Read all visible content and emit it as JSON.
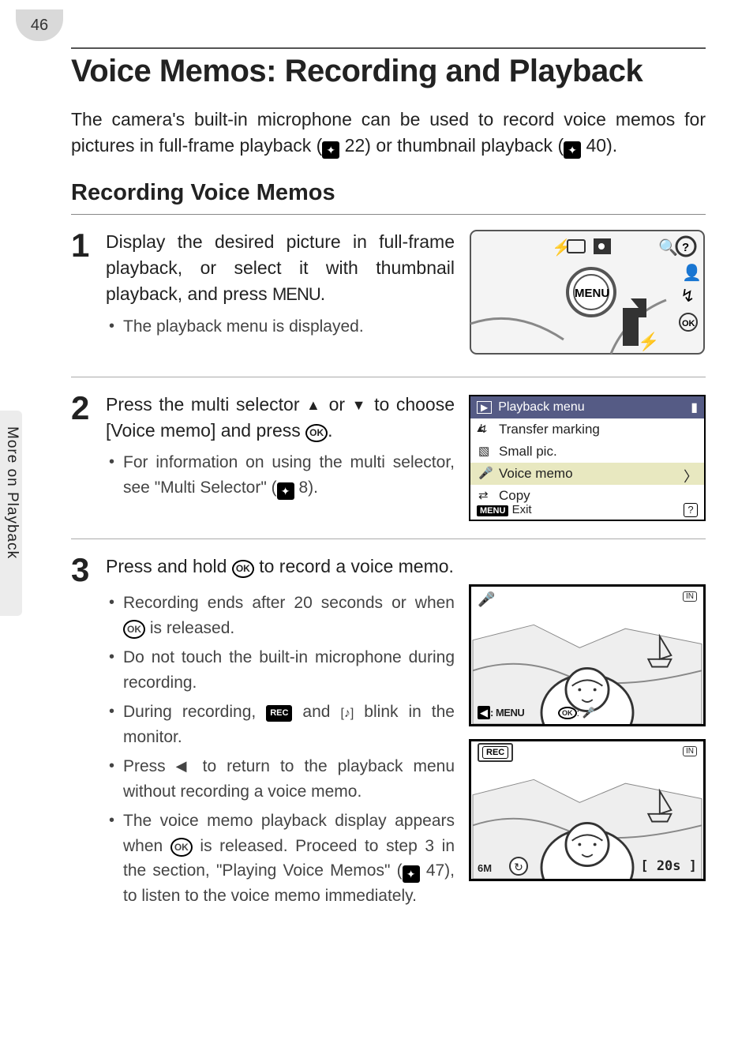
{
  "page_number": "46",
  "title": "Voice Memos: Recording and Playback",
  "intro_parts": {
    "a": "The camera's built-in microphone can be used to record voice memos for pictures in full-frame playback (",
    "ref22": " 22) or thumbnail playback (",
    "ref40": " 40)."
  },
  "h2": "Recording Voice Memos",
  "side_label": "More on Playback",
  "steps": [
    {
      "num": "1",
      "title_a": "Display the desired picture in full-frame playback, or select it with thumbnail playback, and press ",
      "title_menu": "MENU",
      "title_b": ".",
      "bullets": [
        "The playback menu is displayed."
      ]
    },
    {
      "num": "2",
      "title_a": "Press the multi selector ",
      "tri_up": "▲",
      "mid": " or ",
      "tri_dn": "▼",
      "title_b": " to choose [Voice memo] and press ",
      "ok": "OK",
      "title_c": ".",
      "bullets_a": "For information on using the multi selector, see \"Multi Selector\" (",
      "bullets_ref": " 8)."
    },
    {
      "num": "3",
      "title_a": "Press and hold ",
      "ok": "OK",
      "title_b": " to record a voice memo.",
      "b1_a": "Recording ends after 20 seconds or when ",
      "b1_ok": "OK",
      "b1_b": " is released.",
      "b2": "Do not touch the built-in microphone during recording.",
      "b3_a": "During recording, ",
      "b3_rec": "REC",
      "b3_mid": " and ",
      "b3_note": "[♪]",
      "b3_b": " blink in the monitor.",
      "b4_a": "Press ",
      "b4_tri": "◀",
      "b4_b": " to return to the playback menu without recording a voice memo.",
      "b5_a": "The voice memo playback display appears when ",
      "b5_ok": "OK",
      "b5_b": " is released. Proceed to step 3 in the section, \"Playing Voice Memos\" (",
      "b5_ref": " 47), to listen to the voice memo immediately."
    }
  ],
  "menu_screen": {
    "header_icon": "▶",
    "header": "Playback menu",
    "items": [
      {
        "icon": "↯",
        "label": "Transfer marking"
      },
      {
        "icon": "▧",
        "label": "Small pic."
      },
      {
        "icon": "🎤",
        "label": "Voice memo",
        "selected": true
      },
      {
        "icon": "⇄",
        "label": "Copy"
      }
    ],
    "footer_btn": "MENU",
    "footer_label": "Exit",
    "footer_help": "?"
  },
  "photo1": {
    "tl": "🎤",
    "tr": "IN",
    "bl_tri": "◀",
    "bl_menu": ": MENU",
    "br_ok": "OK",
    "br_mic": ": 🎤"
  },
  "photo2": {
    "tl": "REC",
    "tr": "IN",
    "bl": "6M",
    "bc": "↻",
    "br": "[ 20s ]"
  }
}
